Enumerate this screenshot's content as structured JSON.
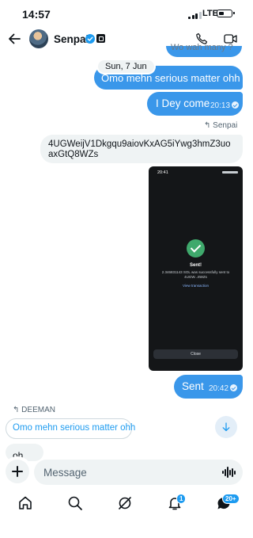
{
  "status_bar": {
    "time": "14:57",
    "network": "LTE"
  },
  "header": {
    "name": "Senpai"
  },
  "messages": {
    "partial_top": "Wo wah many ?",
    "date_separator": "Sun, 7 Jun",
    "msg1_text": "Omo mehn serious matter ohh",
    "msg2_text": "I Dey come",
    "msg2_time": "20:13",
    "reply1_label": "Senpai",
    "msg3_text": "4UGWeijV1Dkgqu9aiovKxAG5iYwg3hmZ3uoaxGtQ8WZs",
    "msg4_text": "Sent",
    "msg4_time": "20:42",
    "reply2_label": "DEEMAN",
    "msg5_text": "Omo mehn serious matter ohh",
    "msg6_text": "oh"
  },
  "attachment": {
    "time": "20:41",
    "title": "Sent!",
    "body": "2.346831143 SOL was successfully sent to 4UGW...8WZs",
    "link": "View transaction",
    "button": "Close"
  },
  "composer": {
    "placeholder": "Message"
  },
  "nav": {
    "notifications_badge": "1",
    "messages_badge": "20+"
  },
  "colors": {
    "accent": "#1d9bf0",
    "outgoing_bubble": "#3a97ea",
    "incoming_bubble": "#eff3f4"
  }
}
